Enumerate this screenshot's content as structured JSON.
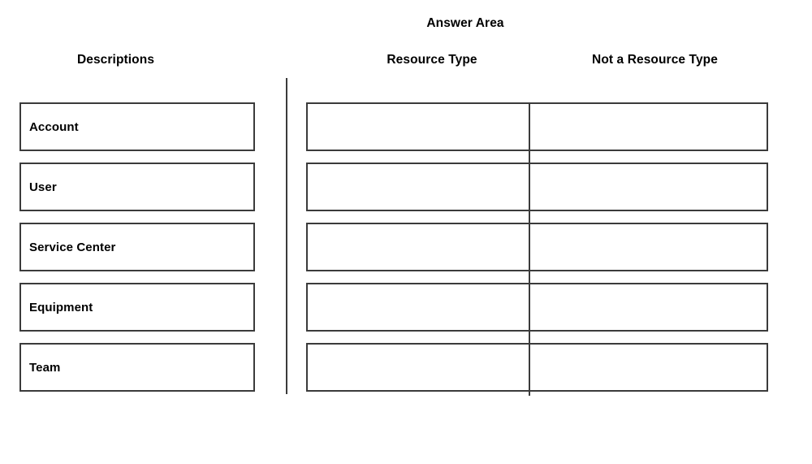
{
  "header": {
    "answer_area_title": "Answer Area"
  },
  "columns": {
    "descriptions_header": "Descriptions",
    "resource_type_header": "Resource Type",
    "not_a_resource_type_header": "Not a Resource Type"
  },
  "descriptions": [
    {
      "label": "Account"
    },
    {
      "label": "User"
    },
    {
      "label": "Service Center"
    },
    {
      "label": "Equipment"
    },
    {
      "label": "Team"
    }
  ],
  "answer_rows": [
    {
      "resource_type": "",
      "not_a_resource_type": ""
    },
    {
      "resource_type": "",
      "not_a_resource_type": ""
    },
    {
      "resource_type": "",
      "not_a_resource_type": ""
    },
    {
      "resource_type": "",
      "not_a_resource_type": ""
    },
    {
      "resource_type": "",
      "not_a_resource_type": ""
    }
  ],
  "colors": {
    "border": "#3b3b3b",
    "text": "#000000",
    "background": "#ffffff"
  }
}
